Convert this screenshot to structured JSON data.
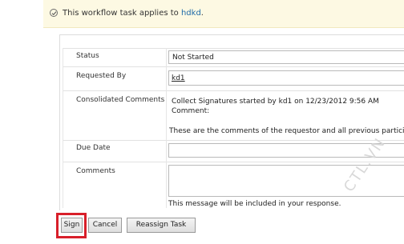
{
  "banner": {
    "text_prefix": "This workflow task applies to ",
    "link_text": "hdkd",
    "text_suffix": ".",
    "icon": "check-circle-icon"
  },
  "form": {
    "status_label": "Status",
    "status_value": "Not Started",
    "requested_by_label": "Requested By",
    "requested_by_value": "kd1",
    "comments_label": "Consolidated Comments",
    "consolidated_line1": "Collect Signatures started by kd1 on 12/23/2012 9:56 AM",
    "consolidated_line2": "Comment:",
    "consolidated_line3": "These are the comments of the requestor and all previous particip",
    "due_date_label": "Due Date",
    "due_date_value": "",
    "comments_field_label": "Comments",
    "comments_value": "",
    "comments_note": "This message will be included in your response."
  },
  "buttons": {
    "sign": "Sign",
    "cancel": "Cancel",
    "reassign": "Reassign Task"
  },
  "watermark": "CTL.VN",
  "colors": {
    "banner_bg": "#fdf9e3",
    "link": "#1e6aa8",
    "highlight": "#d81f2a"
  }
}
